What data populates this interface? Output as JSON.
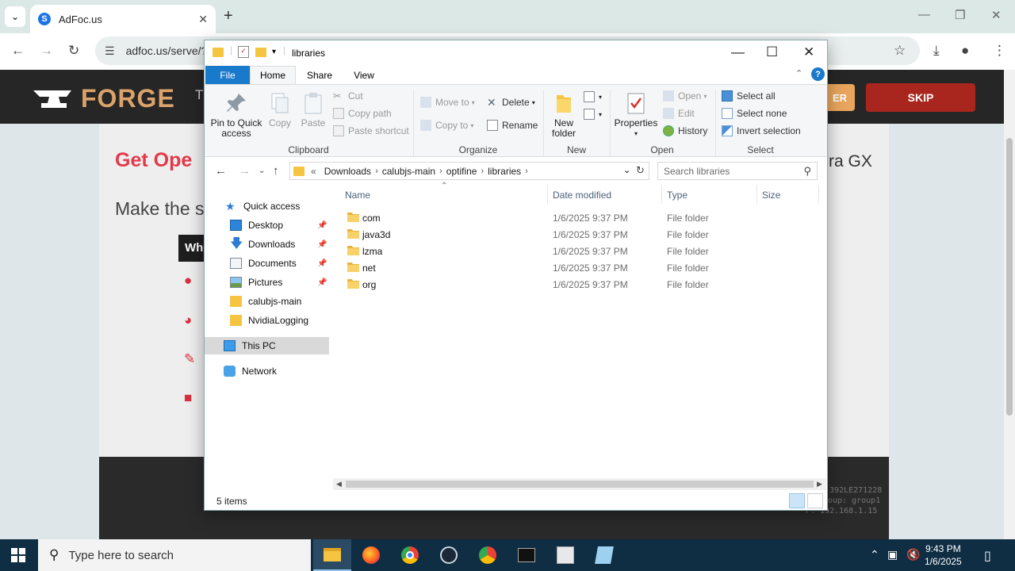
{
  "browser": {
    "tab_title": "AdFoc.us",
    "tab_favicon_letter": "S",
    "url": "adfoc.us/serve/?",
    "icons": [
      "chevron-down-icon",
      "close-icon",
      "plus-icon",
      "minimize-icon",
      "restore-icon",
      "back-arrow-icon",
      "forward-arrow-icon",
      "reload-icon",
      "site-settings-icon",
      "star-icon",
      "download-icon",
      "profile-icon",
      "kebab-menu-icon"
    ]
  },
  "webpage": {
    "logo_text": "FORGE",
    "header_fragment": "T",
    "other_button_fragment": "ER",
    "skip_label": "SKIP",
    "promo_title_fragment": "Get Ope",
    "promo_sub_fragment": "Make the s",
    "opera_fragment": "ra GX",
    "badge_text": "Wh",
    "footer_lines": [
      "392LE271228",
      "oup: group1",
      "P: 192.168.1.15"
    ]
  },
  "explorer": {
    "title": "libraries",
    "ribbon_tabs": [
      "File",
      "Home",
      "Share",
      "View"
    ],
    "help_label": "?",
    "groups": {
      "clipboard": {
        "label": "Clipboard",
        "pin_line1": "Pin to Quick",
        "pin_line2": "access",
        "copy": "Copy",
        "paste": "Paste",
        "cut": "Cut",
        "copy_path": "Copy path",
        "paste_shortcut": "Paste shortcut"
      },
      "organize": {
        "label": "Organize",
        "move_to": "Move to",
        "copy_to": "Copy to",
        "delete": "Delete",
        "rename": "Rename"
      },
      "new": {
        "label": "New",
        "new_folder_line1": "New",
        "new_folder_line2": "folder"
      },
      "open": {
        "label": "Open",
        "properties": "Properties",
        "open": "Open",
        "edit": "Edit",
        "history": "History"
      },
      "select": {
        "label": "Select",
        "select_all": "Select all",
        "select_none": "Select none",
        "invert_selection": "Invert selection"
      }
    },
    "breadcrumb": [
      "Downloads",
      "calubjs-main",
      "optifine",
      "libraries"
    ],
    "breadcrumb_overflow": "«",
    "search_placeholder": "Search libraries",
    "nav": {
      "quick_access": "Quick access",
      "items": [
        {
          "label": "Desktop",
          "pinned": true
        },
        {
          "label": "Downloads",
          "pinned": true
        },
        {
          "label": "Documents",
          "pinned": true
        },
        {
          "label": "Pictures",
          "pinned": true
        },
        {
          "label": "calubjs-main",
          "pinned": false
        },
        {
          "label": "NvidiaLogging",
          "pinned": false
        }
      ],
      "this_pc": "This PC",
      "network": "Network"
    },
    "columns": [
      "Name",
      "Date modified",
      "Type",
      "Size"
    ],
    "files": [
      {
        "name": "com",
        "date": "1/6/2025 9:37 PM",
        "type": "File folder"
      },
      {
        "name": "java3d",
        "date": "1/6/2025 9:37 PM",
        "type": "File folder"
      },
      {
        "name": "lzma",
        "date": "1/6/2025 9:37 PM",
        "type": "File folder"
      },
      {
        "name": "net",
        "date": "1/6/2025 9:37 PM",
        "type": "File folder"
      },
      {
        "name": "org",
        "date": "1/6/2025 9:37 PM",
        "type": "File folder"
      }
    ],
    "status": "5 items"
  },
  "taskbar": {
    "search_placeholder": "Type here to search",
    "time": "9:43 PM",
    "date": "1/6/2025",
    "apps": [
      "file-explorer",
      "firefox",
      "chrome",
      "steam",
      "chrome-alt",
      "terminal",
      "game-app",
      "notepad-app"
    ]
  },
  "colors": {
    "accent_blue": "#1979ca",
    "forge_orange": "#dba36b",
    "skip_red": "#a9261e",
    "promo_red": "#e2394a",
    "folder_yellow": "#f5c542",
    "taskbar": "#0f2d43"
  }
}
